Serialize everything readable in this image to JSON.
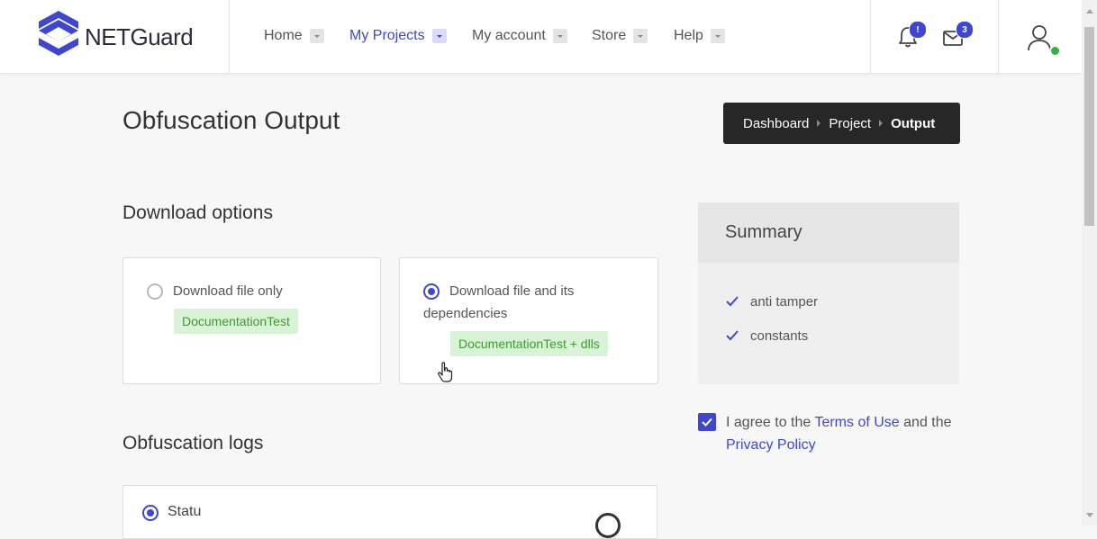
{
  "brand": {
    "name": "NETGuard"
  },
  "nav": {
    "items": [
      {
        "label": "Home",
        "active": false
      },
      {
        "label": "My Projects",
        "active": true
      },
      {
        "label": "My account",
        "active": false
      },
      {
        "label": "Store",
        "active": false
      },
      {
        "label": "Help",
        "active": false
      }
    ]
  },
  "header": {
    "notifications_badge": "!",
    "messages_badge": "3",
    "user_status_color": "#2fb344"
  },
  "page": {
    "title": "Obfuscation Output"
  },
  "breadcrumb": {
    "items": [
      "Dashboard",
      "Project",
      "Output"
    ]
  },
  "download": {
    "section_title": "Download options",
    "options": [
      {
        "label": "Download file only",
        "tag": "DocumentationTest",
        "selected": false
      },
      {
        "label": "Download file and its dependencies",
        "tag": "DocumentationTest + dlls",
        "selected": true
      }
    ]
  },
  "summary": {
    "title": "Summary",
    "items": [
      "anti tamper",
      "constants"
    ]
  },
  "agreement": {
    "checked": true,
    "prefix": "I agree to the",
    "terms_link": "Terms of Use",
    "middle": "and the",
    "privacy_link": "Privacy Policy"
  },
  "logs": {
    "section_title": "Obfuscation logs",
    "status_label": "Statu"
  },
  "colors": {
    "accent": "#3f48cc",
    "tag_bg": "#d9f3d6",
    "tag_text": "#3f9a34",
    "breadcrumb_bg": "#272727"
  }
}
